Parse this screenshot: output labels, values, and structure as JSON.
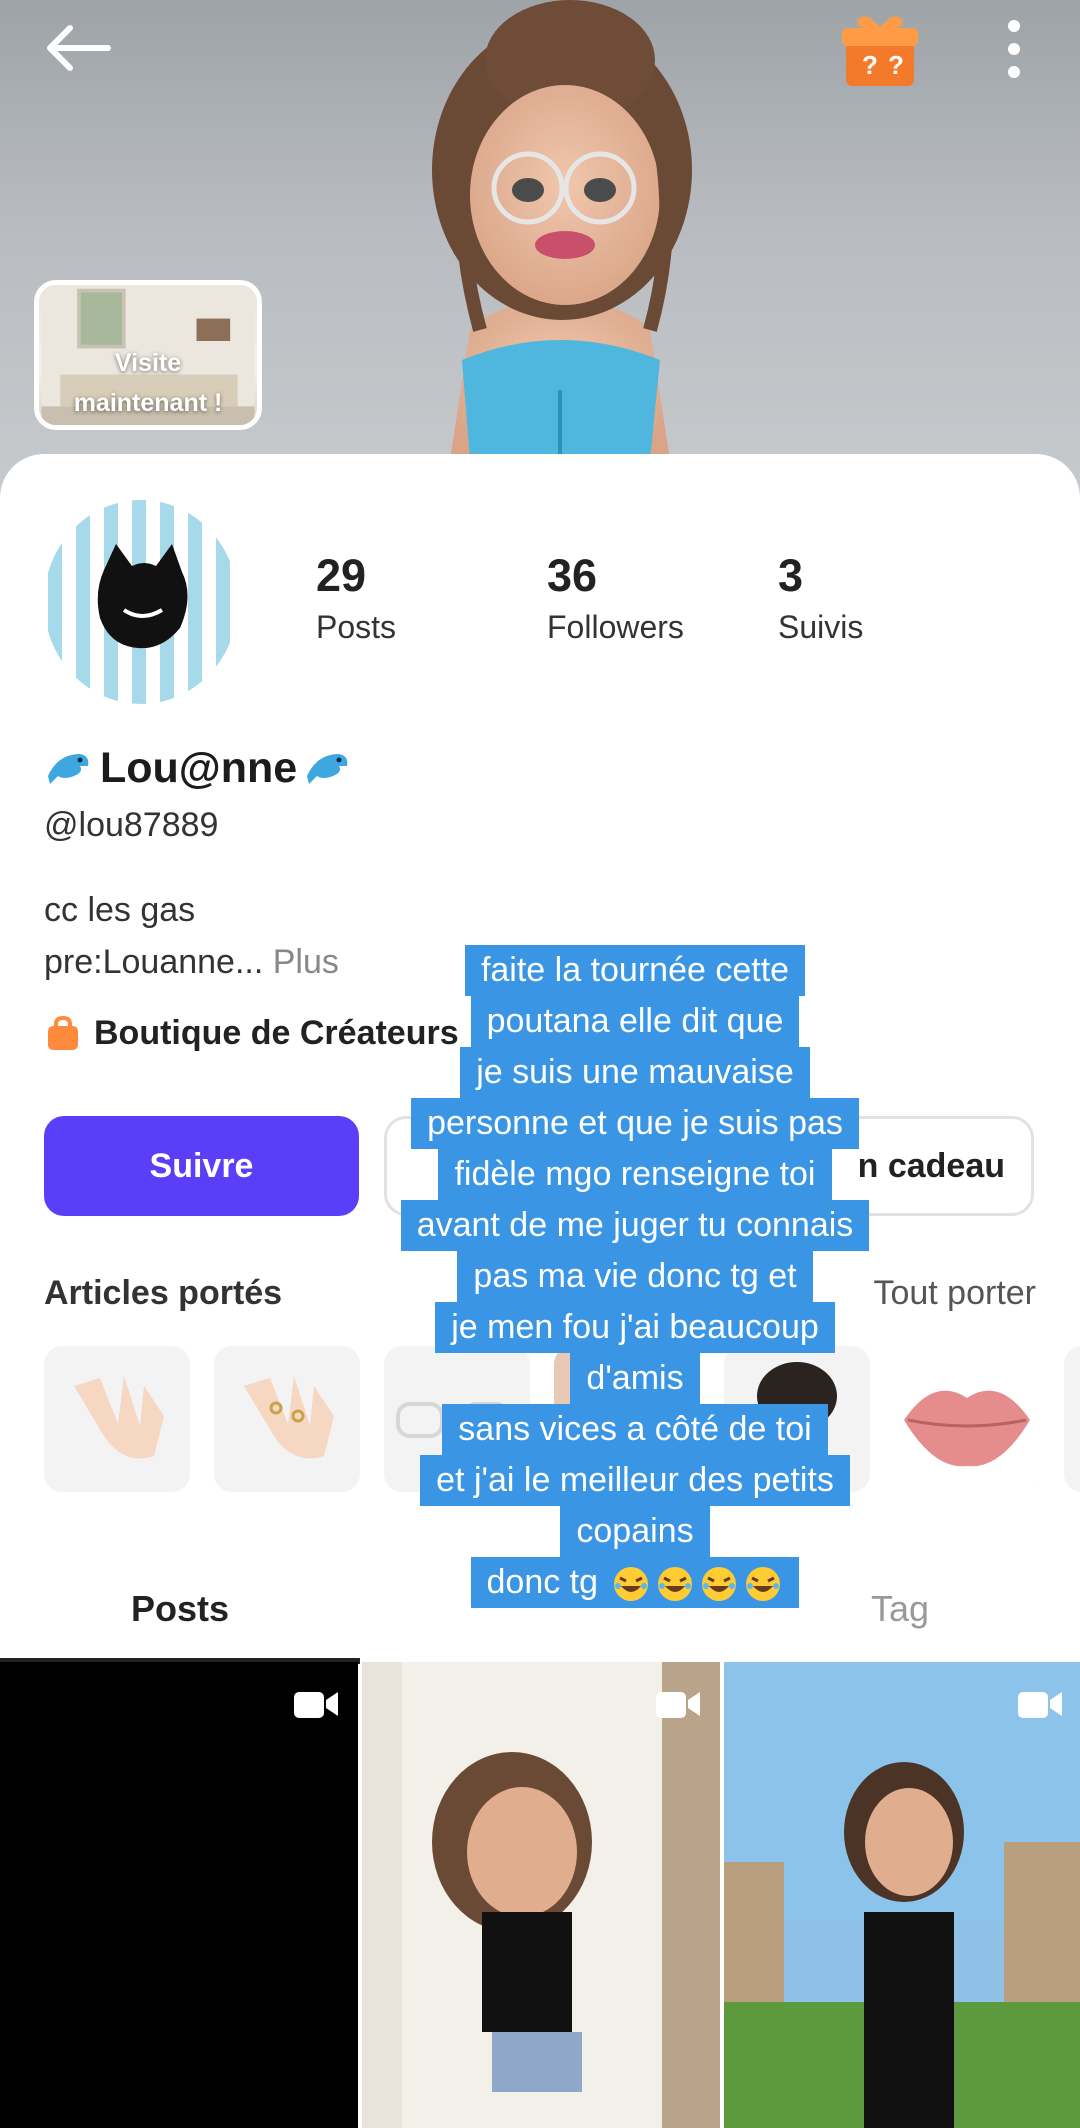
{
  "header": {
    "back_icon": "arrow-left-icon",
    "gift_icon": "mystery-gift-box-icon",
    "more_icon": "vertical-dots-icon",
    "visit_card": {
      "line1": "Visite",
      "line2": "maintenant !"
    }
  },
  "profile": {
    "stats": [
      {
        "value": "29",
        "label": "Posts"
      },
      {
        "value": "36",
        "label": "Followers"
      },
      {
        "value": "3",
        "label": "Suivis"
      }
    ],
    "display_name": "Lou@nne",
    "username": "@lou87889",
    "bio_line1": "cc les gas",
    "bio_line2": "pre:Louanne...",
    "bio_more": "Plus",
    "shop_label": "Boutique de Créateurs"
  },
  "actions": {
    "follow_label": "Suivre",
    "gift_label": "n cadeau"
  },
  "worn_items": {
    "title": "Articles portés",
    "wear_all": "Tout porter"
  },
  "tabs": [
    {
      "label": "Posts"
    },
    {
      "label": "Tag"
    }
  ],
  "caption": {
    "lines": [
      "faite la tournée cette",
      "poutana elle dit que",
      "je suis une mauvaise",
      "personne et que je suis pas",
      "fidèle mgo renseigne toi",
      "avant de me juger tu connais",
      "pas ma vie donc tg et",
      "je men fou j'ai beaucoup",
      "d'amis",
      "sans vices a côté de toi",
      "et j'ai le meilleur des petits",
      "copains"
    ],
    "last_line": "donc tg",
    "emoji": "rolling-on-floor-laughing-emoji"
  },
  "colors": {
    "accent": "#5b3ff8",
    "caption_bg": "#3a96e4",
    "shop_icon": "#ff8a3d"
  }
}
